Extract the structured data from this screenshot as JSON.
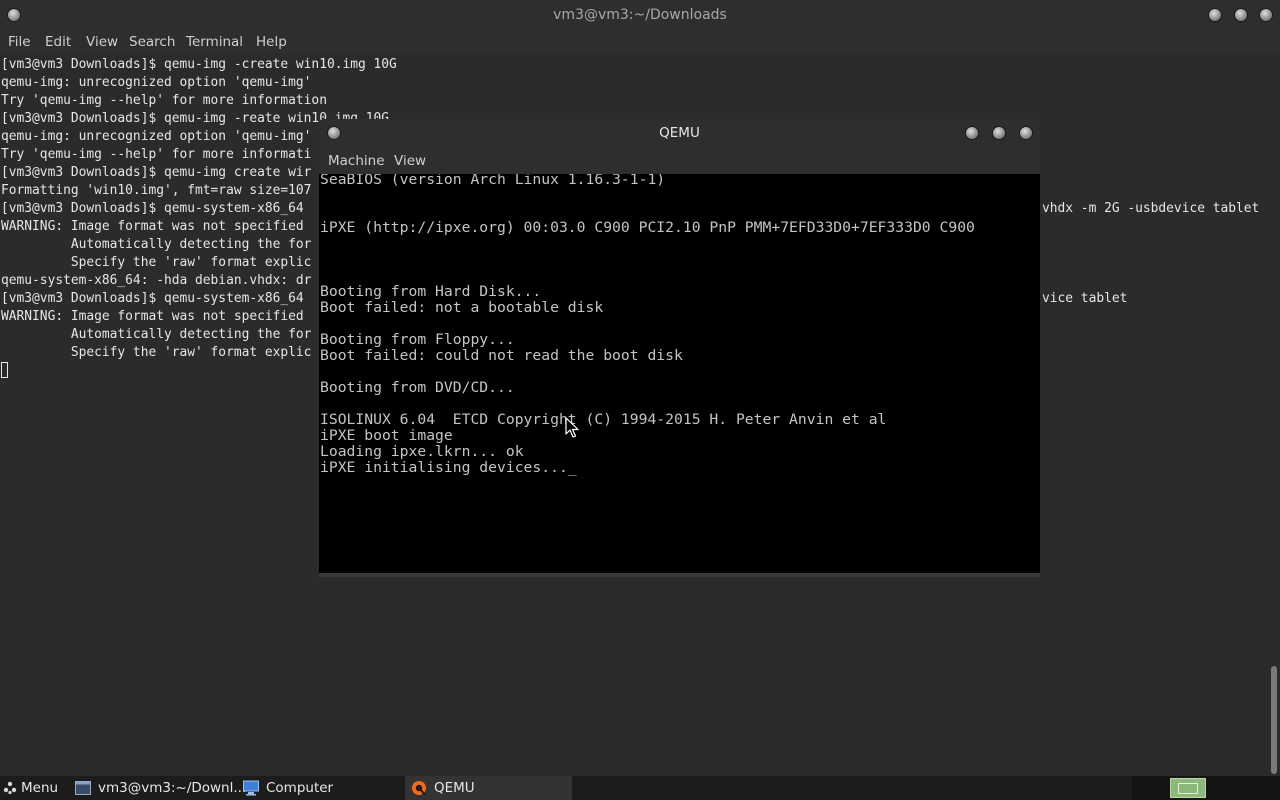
{
  "terminal": {
    "title": "vm3@vm3:~/Downloads",
    "menu": [
      "File",
      "Edit",
      "View",
      "Search",
      "Terminal",
      "Help"
    ],
    "lines": [
      "[vm3@vm3 Downloads]$ qemu-img -create win10.img 10G",
      "qemu-img: unrecognized option 'qemu-img'",
      "Try 'qemu-img --help' for more information",
      "[vm3@vm3 Downloads]$ qemu-img -reate win10.img 10G",
      "qemu-img: unrecognized option 'qemu-img'",
      "Try 'qemu-img --help' for more informati",
      "[vm3@vm3 Downloads]$ qemu-img create wir",
      "Formatting 'win10.img', fmt=raw size=107",
      "[vm3@vm3 Downloads]$ qemu-system-x86_64",
      "WARNING: Image format was not specified",
      "         Automatically detecting the for",
      "         Specify the 'raw' format explic",
      "qemu-system-x86_64: -hda debian.vhdx: dr",
      "[vm3@vm3 Downloads]$ qemu-system-x86_64",
      "WARNING: Image format was not specified",
      "         Automatically detecting the for",
      "         Specify the 'raw' format explic"
    ],
    "right_fragments": [
      "vhdx -m 2G -usbdevice tablet",
      "vice tablet"
    ]
  },
  "qemu": {
    "title": "QEMU",
    "menu": [
      "Machine",
      "View"
    ],
    "screen_lines": [
      "SeaBIOS (version Arch Linux 1.16.3-1-1)",
      "",
      "",
      "iPXE (http://ipxe.org) 00:03.0 C900 PCI2.10 PnP PMM+7EFD33D0+7EF333D0 C900",
      "",
      "",
      "",
      "Booting from Hard Disk...",
      "Boot failed: not a bootable disk",
      "",
      "Booting from Floppy...",
      "Boot failed: could not read the boot disk",
      "",
      "Booting from DVD/CD...",
      "",
      "ISOLINUX 6.04  ETCD Copyright (C) 1994-2015 H. Peter Anvin et al",
      "iPXE boot image",
      "Loading ipxe.lkrn... ok",
      "iPXE initialising devices..._"
    ]
  },
  "taskbar": {
    "menu_label": "Menu",
    "items": [
      {
        "label": "vm3@vm3:~/Downl...",
        "icon": "terminal-icon"
      },
      {
        "label": "Computer",
        "icon": "computer-icon"
      },
      {
        "label": "QEMU",
        "icon": "qemu-icon",
        "active": true
      }
    ]
  },
  "colors": {
    "terminal_bg": "#2b2b2b",
    "titlebar_bg": "#2e2e2e",
    "vga_text": "#c4c4c4",
    "workspace_indicator": "#8db87a"
  }
}
